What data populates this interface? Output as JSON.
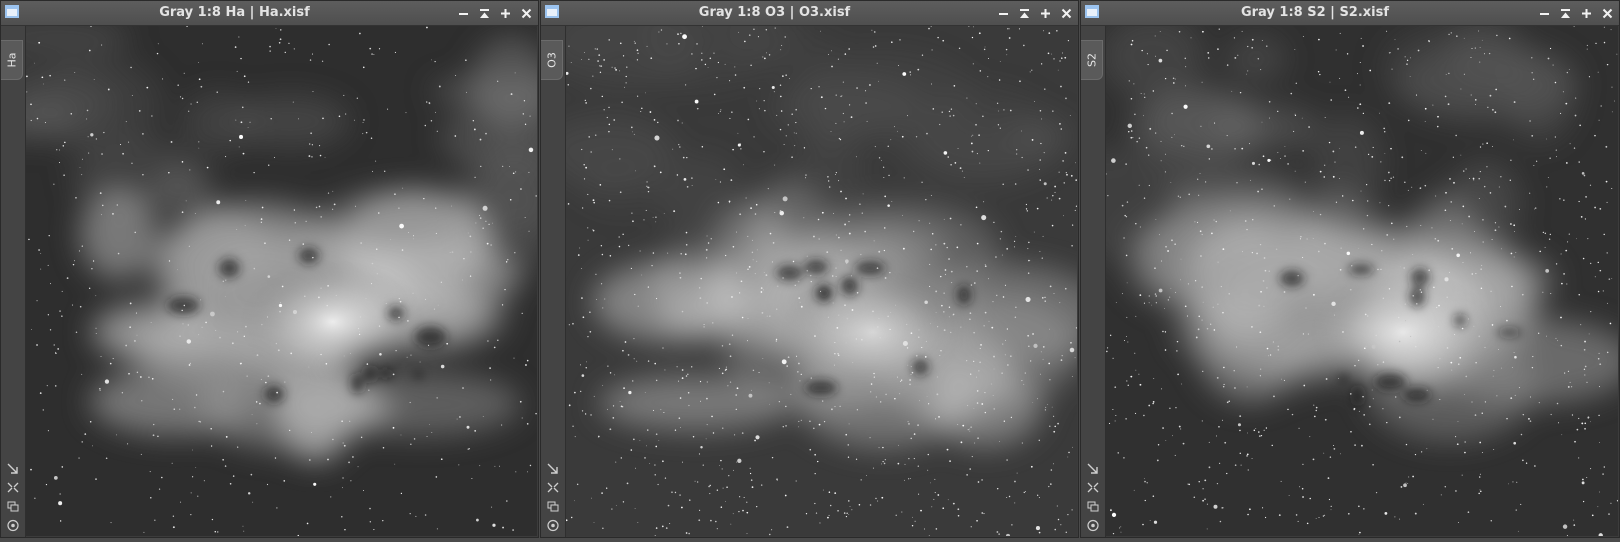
{
  "windows": [
    {
      "id": "ha",
      "title": "Gray 1:8 Ha | Ha.xisf",
      "tab_label": "Ha",
      "icon": "image-window-icon",
      "variant": "ha"
    },
    {
      "id": "o3",
      "title": "Gray 1:8 O3 | O3.xisf",
      "tab_label": "O3",
      "icon": "image-window-icon",
      "variant": "o3"
    },
    {
      "id": "s2",
      "title": "Gray 1:8 S2 | S2.xisf",
      "tab_label": "S2",
      "icon": "image-window-icon",
      "variant": "s2"
    }
  ],
  "controls": [
    "minimize-icon",
    "shade-icon",
    "maximize-icon",
    "close-icon"
  ],
  "side_tools": [
    "fit-view-icon",
    "zoom-fit-icon",
    "clone-icon",
    "identifier-icon"
  ],
  "colors": {
    "titlebar": "#555555",
    "title_text": "#e3e3e3",
    "icon_accent": "#9bc3ef"
  }
}
